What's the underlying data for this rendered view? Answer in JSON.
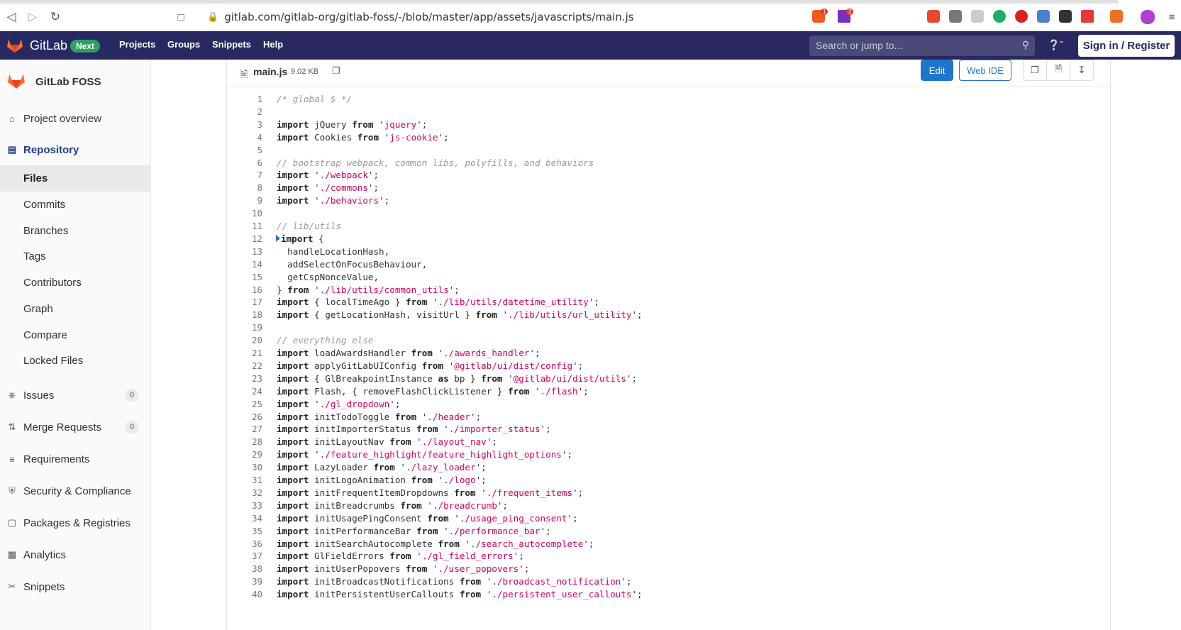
{
  "browser": {
    "url": "gitlab.com/gitlab-org/gitlab-foss/-/blob/master/app/assets/javascripts/main.js",
    "ext_badge_1": "1",
    "ext_badge_2": "2"
  },
  "navbar": {
    "brand": "GitLab",
    "badge": "Next",
    "menu": [
      "Projects",
      "Groups",
      "Snippets",
      "Help"
    ],
    "search_placeholder": "Search or jump to...",
    "signin": "Sign in / Register",
    "colors": {
      "bg": "#292961",
      "badge": "#2da160"
    }
  },
  "sidebar": {
    "project_name": "GitLab FOSS",
    "items": [
      {
        "label": "Project overview",
        "icon": "home-icon"
      },
      {
        "label": "Repository",
        "icon": "document-icon"
      },
      {
        "label": "Issues",
        "icon": "issues-icon",
        "count": "0"
      },
      {
        "label": "Merge Requests",
        "icon": "merge-request-icon",
        "count": "0"
      },
      {
        "label": "Requirements",
        "icon": "requirements-icon"
      },
      {
        "label": "Security & Compliance",
        "icon": "shield-icon"
      },
      {
        "label": "Packages & Registries",
        "icon": "package-icon"
      },
      {
        "label": "Analytics",
        "icon": "chart-icon"
      },
      {
        "label": "Snippets",
        "icon": "scissors-icon"
      }
    ],
    "repo_sub": [
      "Files",
      "Commits",
      "Branches",
      "Tags",
      "Contributors",
      "Graph",
      "Compare",
      "Locked Files"
    ]
  },
  "file": {
    "name": "main.js",
    "size": "9.02 KB",
    "edit": "Edit",
    "web_ide": "Web IDE"
  },
  "code_lines": [
    "/* global $ */",
    "",
    "import jQuery from 'jquery';",
    "import Cookies from 'js-cookie';",
    "",
    "// bootstrap webpack, common libs, polyfills, and behaviors",
    "import './webpack';",
    "import './commons';",
    "import './behaviors';",
    "",
    "// lib/utils",
    "import {",
    "  handleLocationHash,",
    "  addSelectOnFocusBehaviour,",
    "  getCspNonceValue,",
    "} from './lib/utils/common_utils';",
    "import { localTimeAgo } from './lib/utils/datetime_utility';",
    "import { getLocationHash, visitUrl } from './lib/utils/url_utility';",
    "",
    "// everything else",
    "import loadAwardsHandler from './awards_handler';",
    "import applyGitLabUIConfig from '@gitlab/ui/dist/config';",
    "import { GlBreakpointInstance as bp } from '@gitlab/ui/dist/utils';",
    "import Flash, { removeFlashClickListener } from './flash';",
    "import './gl_dropdown';",
    "import initTodoToggle from './header';",
    "import initImporterStatus from './importer_status';",
    "import initLayoutNav from './layout_nav';",
    "import './feature_highlight/feature_highlight_options';",
    "import LazyLoader from './lazy_loader';",
    "import initLogoAnimation from './logo';",
    "import initFrequentItemDropdowns from './frequent_items';",
    "import initBreadcrumbs from './breadcrumb';",
    "import initUsagePingConsent from './usage_ping_consent';",
    "import initPerformanceBar from './performance_bar';",
    "import initSearchAutocomplete from './search_autocomplete';",
    "import GlFieldErrors from './gl_field_errors';",
    "import initUserPopovers from './user_popovers';",
    "import initBroadcastNotifications from './broadcast_notification';",
    "import initPersistentUserCallouts from './persistent_user_callouts';"
  ]
}
